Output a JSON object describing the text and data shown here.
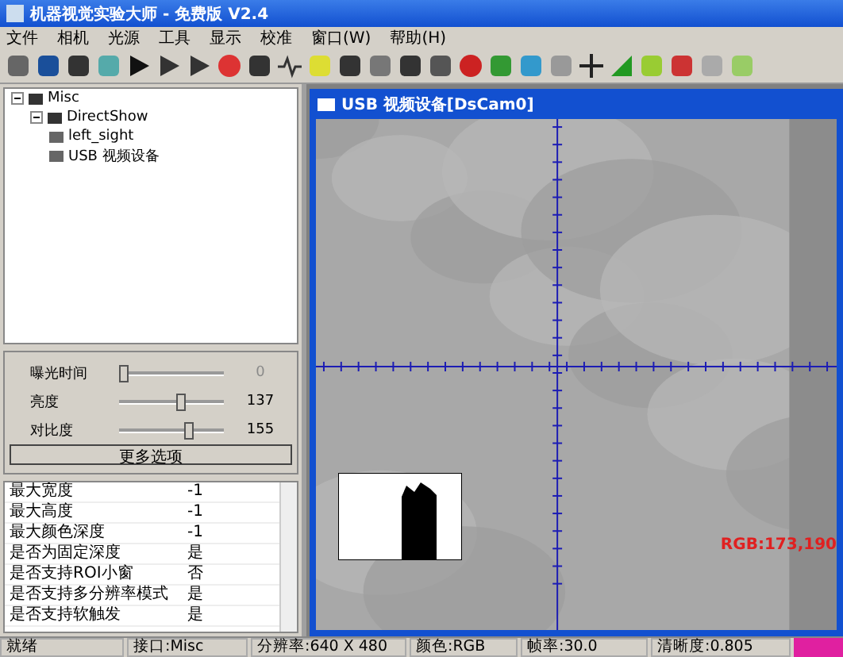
{
  "window": {
    "title": "机器视觉实验大师 - 免费版 V2.4"
  },
  "menu": [
    "文件",
    "相机",
    "光源",
    "工具",
    "显示",
    "校准",
    "窗口(W)",
    "帮助(H)"
  ],
  "tree": [
    {
      "label": "Misc",
      "expanded": true,
      "children": [
        {
          "label": "DirectShow",
          "expanded": true,
          "children": [
            {
              "label": "left_sight"
            },
            {
              "label": "USB 视频设备"
            }
          ]
        }
      ]
    }
  ],
  "sliders": [
    {
      "label": "曝光时间",
      "level": 0.0,
      "reading": "0",
      "disabled": true
    },
    {
      "label": "亮度",
      "level": 0.55,
      "reading": "137",
      "disabled": false
    },
    {
      "label": "对比度",
      "level": 0.62,
      "reading": "155",
      "disabled": false
    }
  ],
  "more_button": "更多选项",
  "properties": [
    [
      "最大宽度",
      "-1"
    ],
    [
      "最大高度",
      "-1"
    ],
    [
      "最大颜色深度",
      "-1"
    ],
    [
      "是否为固定深度",
      "是"
    ],
    [
      "是否支持ROI小窗",
      "否"
    ],
    [
      "是否支持多分辨率模式",
      "是"
    ],
    [
      "是否支持软触发",
      "是"
    ]
  ],
  "child_window": {
    "title": "USB 视频设备[DsCam0]",
    "rgb_reading": "RGB:173,190"
  },
  "status_bar": [
    "就绪",
    "接口:Misc",
    "分辨率:640 X 480",
    "颜色:RGB",
    "帧率:30.0",
    "清晰度:0.805"
  ]
}
